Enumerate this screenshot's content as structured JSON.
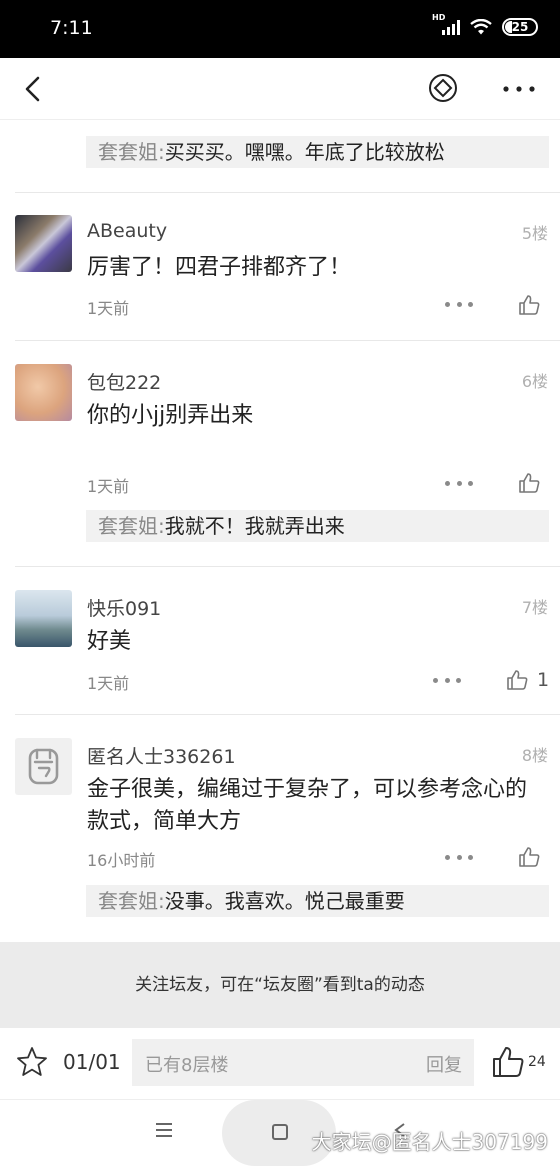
{
  "status_bar": {
    "time": "7:11",
    "network": "HD",
    "battery": "25"
  },
  "nav": {
    "back_icon": "back-arrow-icon",
    "coin_icon": "coin-icon",
    "more_icon": "more-icon"
  },
  "top_reply": {
    "name": "套套姐",
    "separator": ":",
    "text": "买买买。嘿嘿。年底了比较放松"
  },
  "posts": [
    {
      "user": "ABeauty",
      "floor": "5楼",
      "content": "厉害了！四君子排都齐了！",
      "time": "1天前",
      "likes": ""
    },
    {
      "user": "包包222",
      "floor": "6楼",
      "content": "你的小jj别弄出来",
      "time": "1天前",
      "likes": "",
      "reply": {
        "name": "套套姐",
        "separator": ":",
        "text": "我就不！我就弄出来"
      }
    },
    {
      "user": "快乐091",
      "floor": "7楼",
      "content": "好美",
      "time": "1天前",
      "likes": "1"
    },
    {
      "user": "匿名人士336261",
      "floor": "8楼",
      "content": "金子很美，编绳过于复杂了，可以参考念心的款式，简单大方",
      "time": "16小时前",
      "likes": "",
      "reply": {
        "name": "套套姐",
        "separator": ":",
        "text": "没事。我喜欢。悦己最重要"
      }
    }
  ],
  "follow_banner": "关注坛友，可在“坛友圈”看到ta的动态",
  "bottom_bar": {
    "pager": "01/01",
    "placeholder": "已有8层楼",
    "reply_button": "回复",
    "like_count": "24"
  },
  "watermark": "大家坛@匿名人士307199",
  "colors": {
    "divider": "#e8e8e8",
    "reply_bg": "#f1f1f1",
    "banner_bg": "#ebebeb"
  }
}
